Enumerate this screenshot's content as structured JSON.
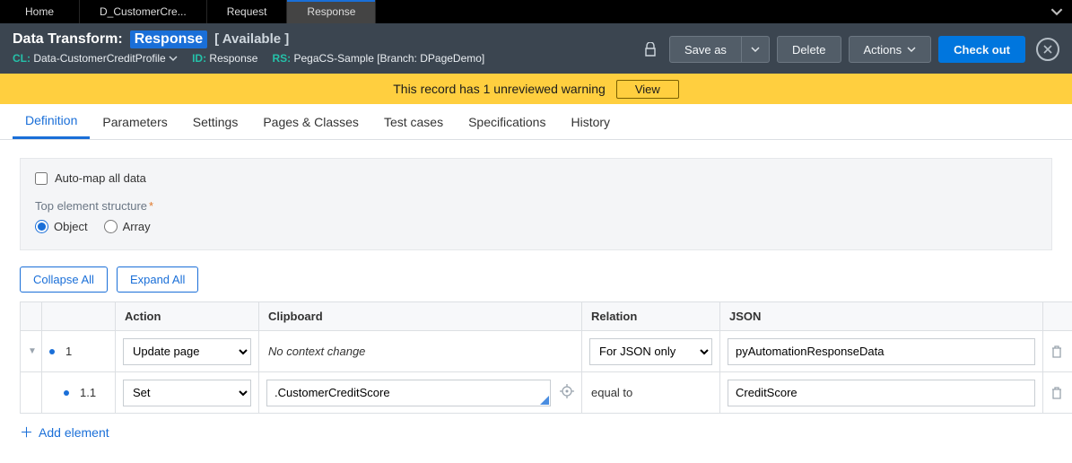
{
  "topTabs": [
    "Home",
    "D_CustomerCre...",
    "Request",
    "Response"
  ],
  "activeTopTab": 3,
  "header": {
    "prefix": "Data Transform:",
    "name": "Response",
    "availability": "[ Available ]",
    "cl_key": "CL:",
    "cl_val": "Data-CustomerCreditProfile",
    "id_key": "ID:",
    "id_val": "Response",
    "rs_key": "RS:",
    "rs_val": "PegaCS-Sample [Branch: DPageDemo]"
  },
  "actions": {
    "save_as": "Save as",
    "delete": "Delete",
    "actions": "Actions",
    "check_out": "Check out"
  },
  "warning": {
    "text": "This record has 1 unreviewed warning",
    "button": "View"
  },
  "subTabs": [
    "Definition",
    "Parameters",
    "Settings",
    "Pages & Classes",
    "Test cases",
    "Specifications",
    "History"
  ],
  "activeSubTab": 0,
  "form": {
    "automap_label": "Auto-map all data",
    "automap_checked": false,
    "structure_label": "Top element structure",
    "radio_object": "Object",
    "radio_array": "Array",
    "structure_value": "Object"
  },
  "controls": {
    "collapse_all": "Collapse All",
    "expand_all": "Expand All",
    "add_element": "Add element"
  },
  "columns": {
    "action": "Action",
    "clipboard": "Clipboard",
    "relation": "Relation",
    "json": "JSON"
  },
  "rows": [
    {
      "step": "1",
      "indent": 0,
      "expandable": true,
      "action": "Update page",
      "clipboard_text": "No context change",
      "clipboard_editable": false,
      "relation": "For JSON only",
      "relation_type": "select",
      "json": "pyAutomationResponseData"
    },
    {
      "step": "1.1",
      "indent": 1,
      "expandable": false,
      "action": "Set",
      "clipboard_text": ".CustomerCreditScore",
      "clipboard_editable": true,
      "relation": "equal to",
      "relation_type": "text",
      "json": "CreditScore"
    }
  ]
}
